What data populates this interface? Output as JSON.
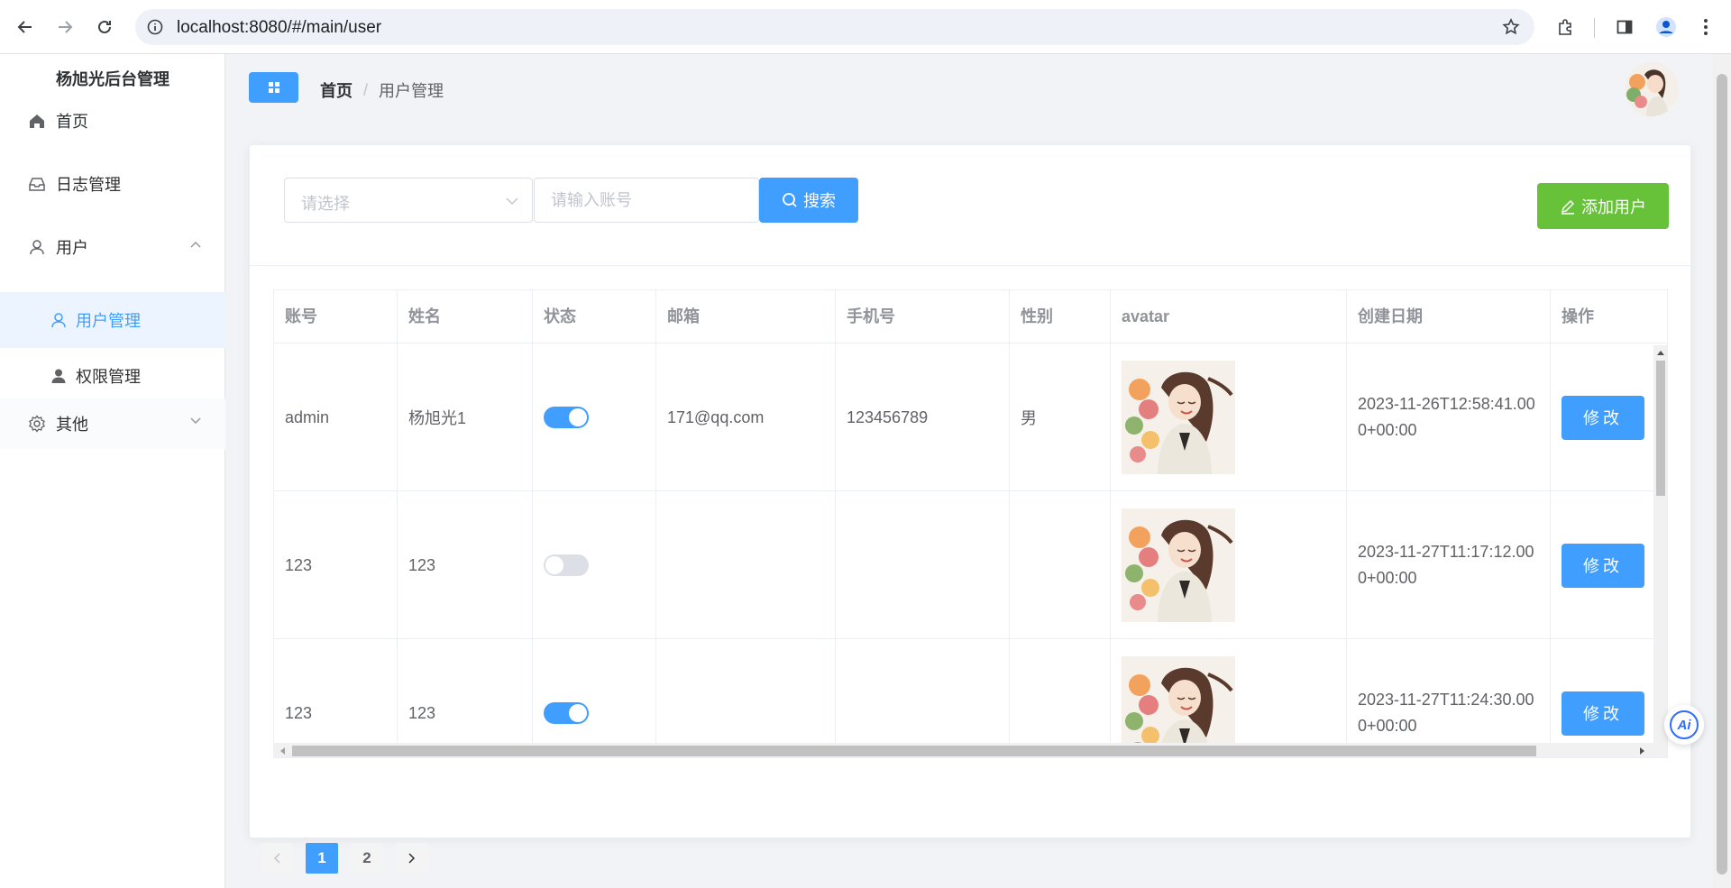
{
  "browser": {
    "url": "localhost:8080/#/main/user"
  },
  "sidebar": {
    "brand": "杨旭光后台管理",
    "items": [
      {
        "label": "首页",
        "icon": "home-icon"
      },
      {
        "label": "日志管理",
        "icon": "inbox-icon"
      },
      {
        "label": "用户",
        "icon": "user-icon",
        "expanded": true
      },
      {
        "label": "其他",
        "icon": "gear-icon",
        "expanded": false
      }
    ],
    "sub_items": [
      {
        "label": "用户管理",
        "icon": "user-icon",
        "active": true
      },
      {
        "label": "权限管理",
        "icon": "user-filled-icon",
        "active": false
      }
    ]
  },
  "header": {
    "breadcrumb_home": "首页",
    "breadcrumb_sep": "/",
    "breadcrumb_current": "用户管理"
  },
  "toolbar": {
    "select_placeholder": "请选择",
    "search_placeholder": "请输入账号",
    "search_label": "搜索",
    "add_label": "添加用户"
  },
  "table": {
    "columns": [
      "账号",
      "姓名",
      "状态",
      "邮箱",
      "手机号",
      "性别",
      "avatar",
      "创建日期",
      "操作"
    ],
    "rows": [
      {
        "account": "admin",
        "name": "杨旭光1",
        "status": true,
        "email": "171@qq.com",
        "phone": "123456789",
        "gender": "男",
        "created": "2023-11-26T12:58:41.000+00:00",
        "action": "修改"
      },
      {
        "account": "123",
        "name": "123",
        "status": false,
        "email": "",
        "phone": "",
        "gender": "",
        "created": "2023-11-27T11:17:12.000+00:00",
        "action": "修改"
      },
      {
        "account": "123",
        "name": "123",
        "status": true,
        "email": "",
        "phone": "",
        "gender": "",
        "created": "2023-11-27T11:24:30.000+00:00",
        "action": "修改"
      }
    ]
  },
  "pagination": {
    "pages": [
      "1",
      "2"
    ],
    "current": "1"
  },
  "colors": {
    "primary": "#409eff",
    "success": "#67c23a",
    "active_bg": "#ecf5ff"
  },
  "ai_badge": "Ai"
}
